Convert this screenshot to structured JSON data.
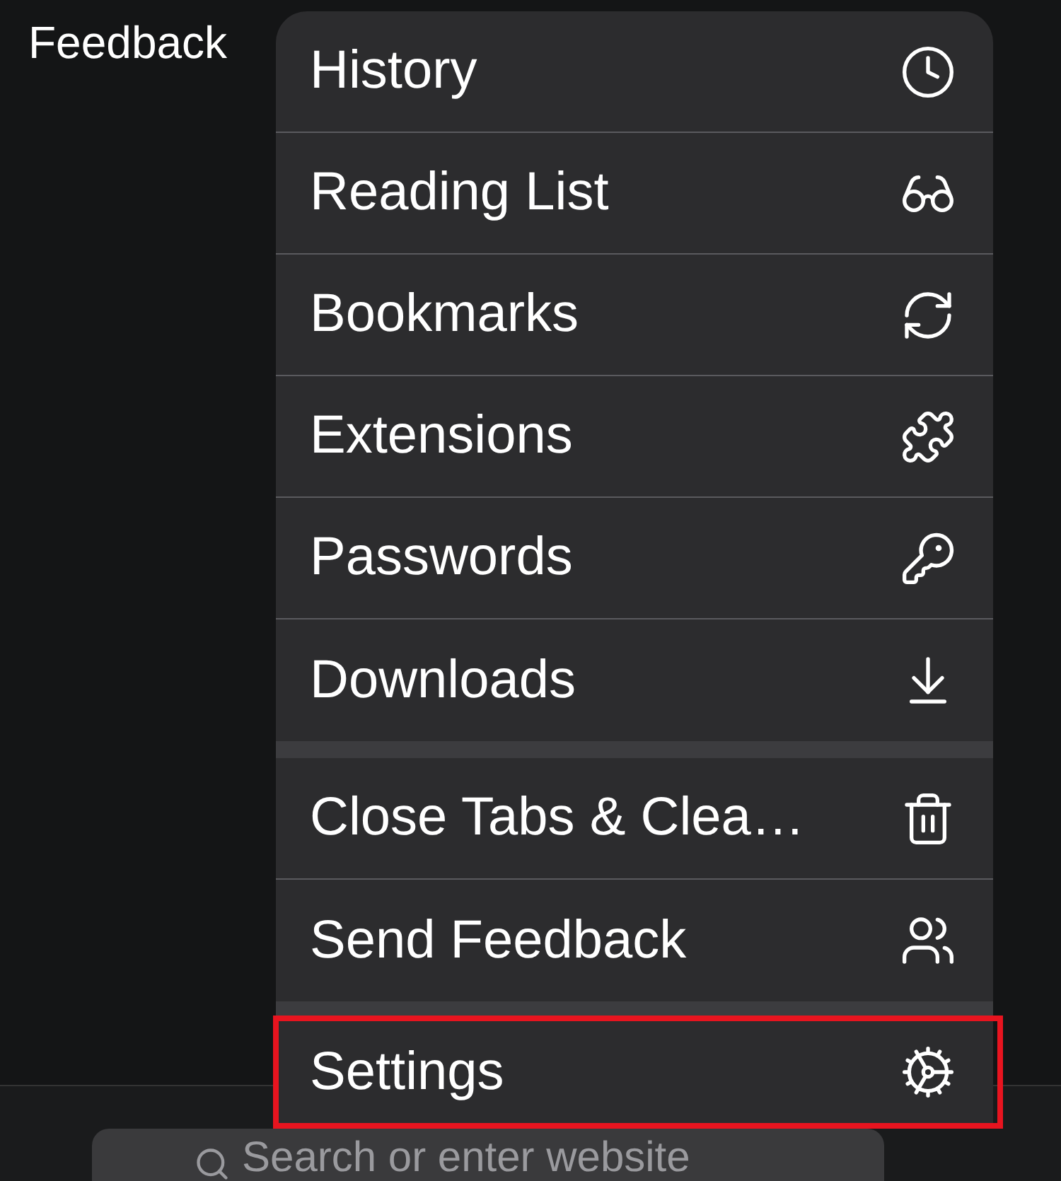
{
  "top_label": "Feedback",
  "menu": {
    "groups": [
      [
        {
          "label": "History",
          "highlighted": false
        },
        {
          "label": "Reading List",
          "highlighted": false
        },
        {
          "label": "Bookmarks",
          "highlighted": false
        },
        {
          "label": "Extensions",
          "highlighted": false
        },
        {
          "label": "Passwords",
          "highlighted": false
        },
        {
          "label": "Downloads",
          "highlighted": false
        }
      ],
      [
        {
          "label": "Close Tabs & Clea…",
          "highlighted": false
        },
        {
          "label": "Send Feedback",
          "highlighted": false
        }
      ],
      [
        {
          "label": "Settings",
          "highlighted": true
        }
      ]
    ]
  },
  "toolbar": {
    "search": {
      "placeholder": "Search or enter website"
    }
  }
}
